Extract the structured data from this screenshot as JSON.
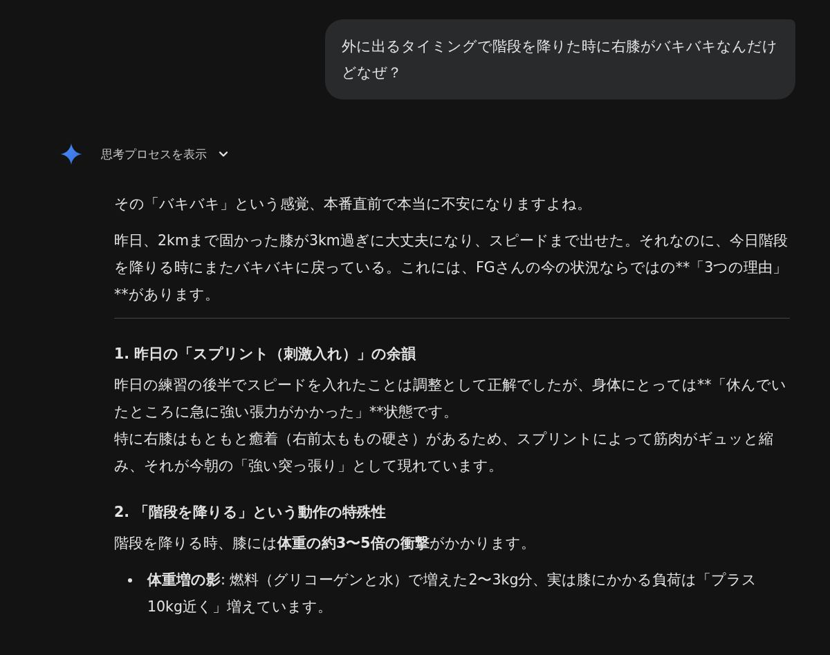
{
  "user_message": {
    "text": "外に出るタイミングで階段を降りた時に右膝がバキバキなんだけどなぜ？"
  },
  "thinking_toggle": {
    "label": "思考プロセスを表示",
    "expanded": false
  },
  "response": [
    {
      "kind": "paragraph",
      "lines": [
        {
          "parts": [
            {
              "text": "その「バキバキ」という感覚、本番直前で本当に不安になりますよね。",
              "bold": false
            }
          ]
        }
      ]
    },
    {
      "kind": "paragraph",
      "lines": [
        {
          "parts": [
            {
              "text": "昨日、2kmまで固かった膝が3km過ぎに大丈夫になり、スピードまで出せた。それなのに、今日階段を降りる時にまたバキバキに戻っている。これには、FGさんの今の状況ならではの**「3つの理由」**があります。",
              "bold": false
            }
          ]
        }
      ]
    },
    {
      "kind": "divider"
    },
    {
      "kind": "heading",
      "text": "1. 昨日の「スプリント（刺激入れ）」の余韻"
    },
    {
      "kind": "paragraph",
      "lines": [
        {
          "parts": [
            {
              "text": "昨日の練習の後半でスピードを入れたことは調整として正解でしたが、身体にとっては**「休んでいたところに急に強い張力がかかった」**状態です。",
              "bold": false
            }
          ]
        },
        {
          "parts": [
            {
              "text": "特に右膝はもともと癒着（右前太ももの硬さ）があるため、スプリントによって筋肉がギュッと縮み、それが今朝の「強い突っ張り」として現れています。",
              "bold": false
            }
          ]
        }
      ]
    },
    {
      "kind": "heading",
      "text": "2. 「階段を降りる」という動作の特殊性"
    },
    {
      "kind": "paragraph",
      "lines": [
        {
          "parts": [
            {
              "text": "階段を降りる時、膝には",
              "bold": false
            },
            {
              "text": "体重の約3〜5倍の衝撃",
              "bold": true
            },
            {
              "text": "がかかります。",
              "bold": false
            }
          ]
        }
      ]
    },
    {
      "kind": "bullet",
      "lines": [
        {
          "parts": [
            {
              "text": "体重増の影",
              "bold": true
            },
            {
              "text": ": 燃料（グリコーゲンと水）で増えた2〜3kg分、実は膝にかかる負荷は「プラス10kg近く」増えています。",
              "bold": false
            }
          ]
        }
      ]
    }
  ]
}
